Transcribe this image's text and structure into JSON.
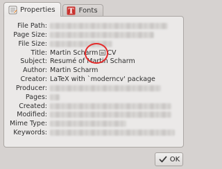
{
  "tabs": [
    {
      "label": "Properties",
      "icon": "properties-icon",
      "active": true
    },
    {
      "label": "Fonts",
      "icon": "fonts-icon",
      "active": false
    }
  ],
  "fields": {
    "file_path": {
      "label": "File Path:"
    },
    "page_size": {
      "label": "Page Size:"
    },
    "file_size": {
      "label": "File Size:"
    },
    "title": {
      "label": "Title:",
      "value_before": "Martin Scharm",
      "value_after": "CV"
    },
    "subject": {
      "label": "Subject:",
      "value": "Resumé of Martin Scharm"
    },
    "author": {
      "label": "Author:",
      "value": "Martin Scharm"
    },
    "creator": {
      "label": "Creator:",
      "value": "LaTeX with `moderncv' package"
    },
    "producer": {
      "label": "Producer:"
    },
    "pages": {
      "label": "Pages:"
    },
    "created": {
      "label": "Created:"
    },
    "modified": {
      "label": "Modified:"
    },
    "mime_type": {
      "label": "Mime Type:"
    },
    "keywords": {
      "label": "Keywords:"
    }
  },
  "ok_button": {
    "label": "OK",
    "icon": "checkmark-icon"
  },
  "colors": {
    "highlight_ring": "#e52b2b",
    "panel_bg": "#ebe9e8",
    "window_bg": "#d6d2d0"
  }
}
